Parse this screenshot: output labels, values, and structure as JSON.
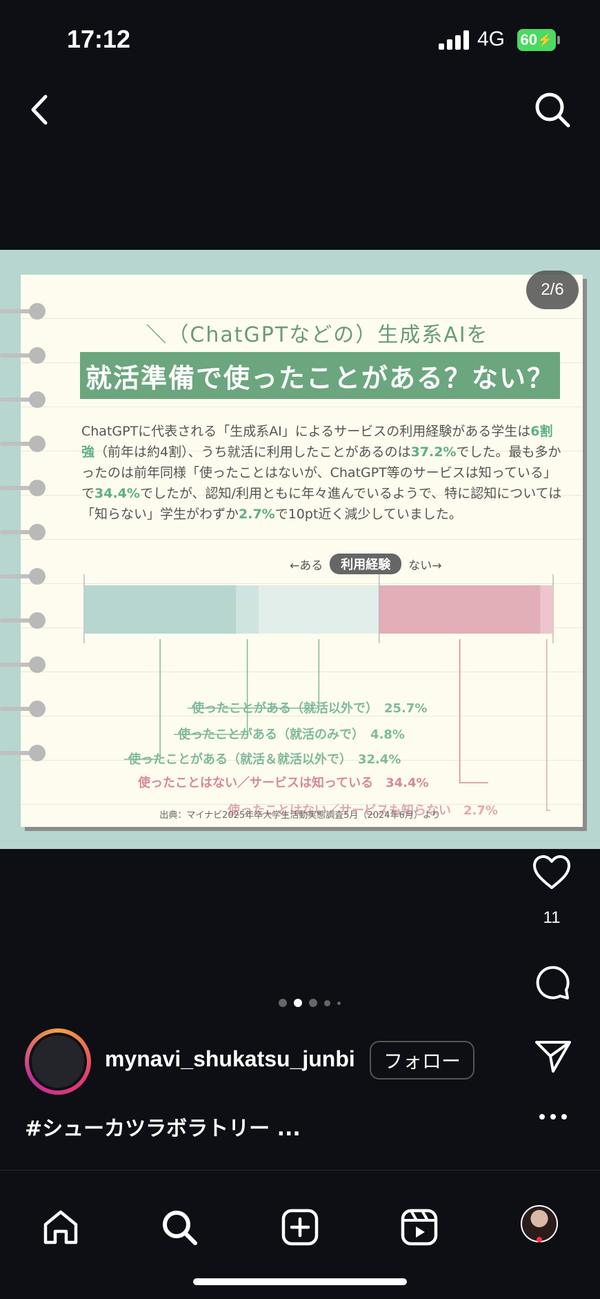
{
  "status_bar": {
    "time": "17:12",
    "network": "4G",
    "battery": "60"
  },
  "post": {
    "page_indicator": "2/6",
    "headline_sub": "＼（ChatGPTなどの）生成系AIを／",
    "headline_main": "就活準備で使ったことがある？ない？",
    "body": {
      "p1": "ChatGPTに代表される「生成系AI」によるサービスの利用経験がある学生は",
      "p2_hl": "6割強",
      "p3": "（前年は約4割）、うち就活に利用したことがあるのは",
      "p4_hl": "37.2%",
      "p5": "でした。最も多かったのは前年同様「使ったことはないが、ChatGPT等のサービスは知っている」で",
      "p6_hl": "34.4%",
      "p7": "でしたが、認知/利用ともに年々進んでいるようで、特に認知については「知らない」学生がわずか",
      "p8_hl": "2.7%",
      "p9": "で10pt近く減少していました。"
    },
    "axis": {
      "left": "←ある",
      "center": "利用経験",
      "right": "ない→"
    },
    "source": "出典：マイナビ2025年卒大学生活動実態調査5月（2024年6月）より"
  },
  "chart_data": {
    "type": "bar",
    "orientation": "horizontal-stacked",
    "categories": [
      "利用経験"
    ],
    "series": [
      {
        "name": "使ったことがある（就活＆就活以外で）",
        "values": [
          32.4
        ],
        "color": "#b6d6cf"
      },
      {
        "name": "使ったことがある（就活のみで）",
        "values": [
          4.8
        ],
        "color": "#cfe4de"
      },
      {
        "name": "使ったことがある（就活以外で）",
        "values": [
          25.7
        ],
        "color": "#e2eeea"
      },
      {
        "name": "使ったことはない／サービスは知っている",
        "values": [
          34.4
        ],
        "color": "#e2aeb8"
      },
      {
        "name": "使ったことはない／サービスも知らない",
        "values": [
          2.7
        ],
        "color": "#eec5cc"
      }
    ],
    "labels": [
      {
        "text": "使ったことがある（就活以外で）",
        "value": "25.7%",
        "color": "#7fb99c"
      },
      {
        "text": "使ったことがある（就活のみで）",
        "value": "4.8%",
        "color": "#7fb99c"
      },
      {
        "text": "使ったことがある（就活＆就活以外で）",
        "value": "32.4%",
        "color": "#7fb99c"
      },
      {
        "text": "使ったことはない／サービスは知っている",
        "value": "34.4%",
        "color": "#d48a9c"
      },
      {
        "text": "使ったことはない／サービスも知らない",
        "value": "2.7%",
        "color": "#e0a8b4"
      }
    ],
    "xlim": [
      0,
      100
    ]
  },
  "actions": {
    "like_count": "11"
  },
  "account": {
    "username": "mynavi_shukatsu_junbi",
    "follow_label": "フォロー"
  },
  "caption": "#シューカツラボラトリー ...",
  "icons": {
    "back": "chevron-left-icon",
    "search": "search-icon",
    "like": "heart-icon",
    "comment": "comment-icon",
    "share": "send-icon",
    "more": "more-icon",
    "home": "home-icon",
    "explore": "search-icon",
    "create": "plus-square-icon",
    "reels": "reels-icon"
  }
}
